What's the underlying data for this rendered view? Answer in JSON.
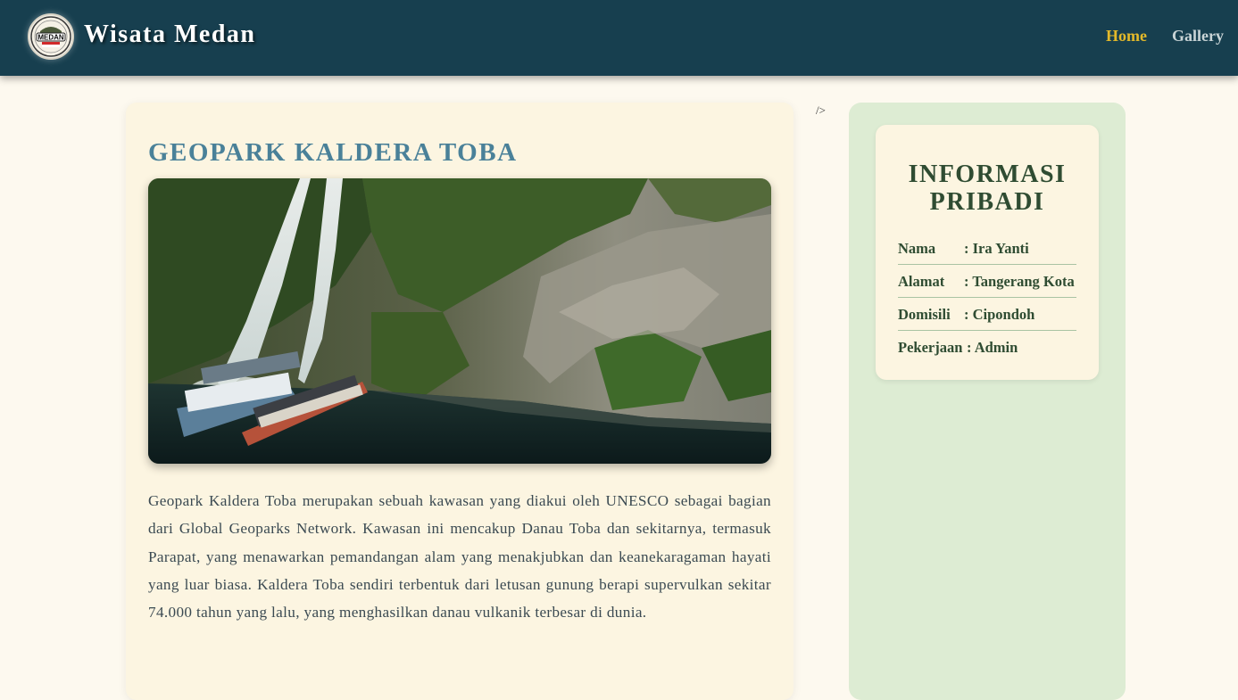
{
  "header": {
    "site_title": "Wisata Medan",
    "logo_text": "MEDAN",
    "nav": [
      {
        "label": "Home",
        "active": true
      },
      {
        "label": "Gallery",
        "active": false
      }
    ],
    "colors": {
      "bar": "#173f4f",
      "active_link": "#e3b92a"
    }
  },
  "stray_text": "/>",
  "article": {
    "title": "GEOPARK KALDERA TOBA",
    "image_subject": "waterfall over rocky cliff with tourist boats on lake",
    "body": "Geopark Kaldera Toba merupakan sebuah kawasan yang diakui oleh UNESCO sebagai bagian dari Global Geoparks Network. Kawasan ini mencakup Danau Toba dan sekitarnya, termasuk Parapat, yang menawarkan pemandangan alam yang menakjubkan dan keanekaragaman hayati yang luar biasa. Kaldera Toba sendiri terbentuk dari letusan gunung berapi supervulkan sekitar 74.000 tahun yang lalu, yang menghasilkan danau vulkanik terbesar di dunia."
  },
  "sidebar": {
    "title": "INFORMASI PRIBADI",
    "rows": [
      {
        "key": "Nama",
        "value": ": Ira Yanti"
      },
      {
        "key": "Alamat",
        "value": ": Tangerang Kota"
      },
      {
        "key": "Domisili",
        "value": ": Cipondoh"
      },
      {
        "key": "Pekerjaan",
        "value": ": Admin"
      }
    ]
  }
}
